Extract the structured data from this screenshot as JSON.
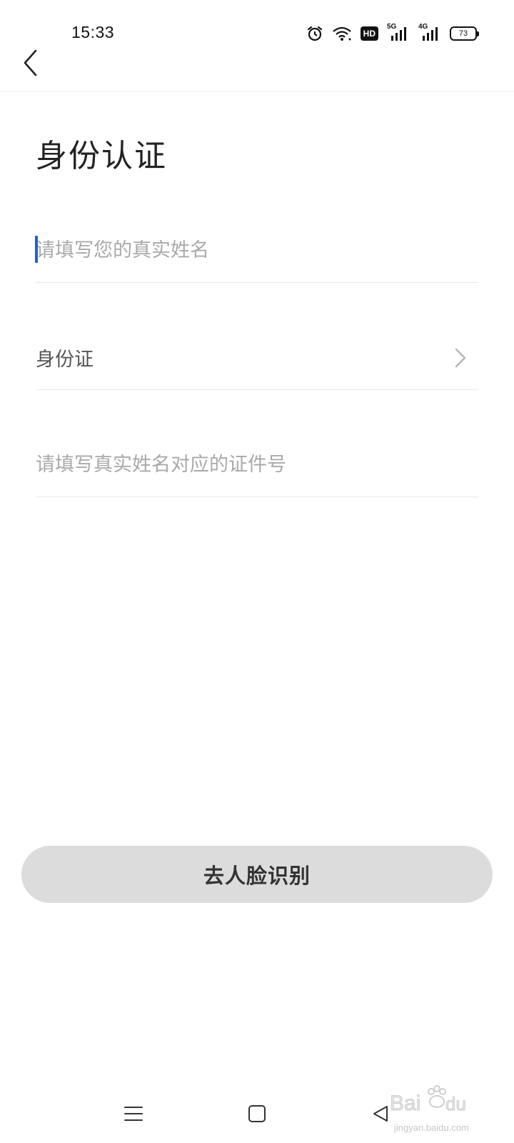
{
  "status_bar": {
    "time": "15:33",
    "hd_label": "HD",
    "network_5g": "5G",
    "network_4g": "4G",
    "battery_level": "73"
  },
  "header": {
    "back_icon": "chevron-left-icon"
  },
  "page": {
    "title": "身份认证"
  },
  "form": {
    "name_placeholder": "请填写您的真实姓名",
    "name_value": "",
    "id_type_label": "身份证",
    "id_number_placeholder": "请填写真实姓名对应的证件号",
    "id_number_value": ""
  },
  "actions": {
    "face_recognition_label": "去人脸识别"
  },
  "nav_bar": {
    "menu_icon": "menu-icon",
    "home_icon": "home-icon",
    "back_icon": "back-triangle-icon"
  },
  "watermark": {
    "text": "jingyan.baidu.com"
  },
  "colors": {
    "accent": "#2a5cd6",
    "button_bg": "#dcdcdc",
    "placeholder": "#a9a9a9",
    "divider": "#e8e8e8"
  }
}
